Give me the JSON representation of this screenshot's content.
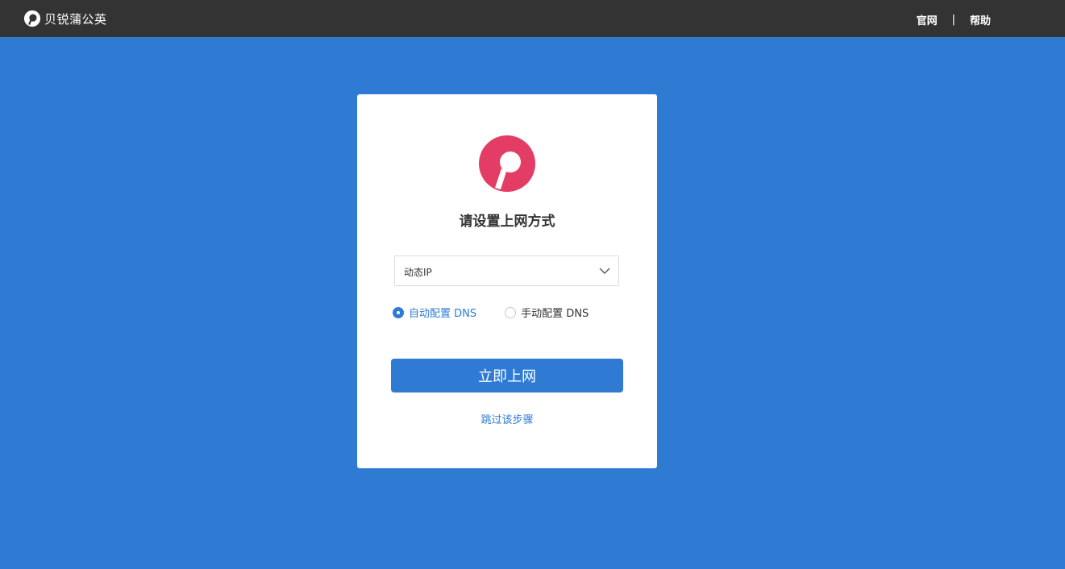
{
  "header": {
    "brand_name": "贝锐蒲公英",
    "nav": {
      "official_site": "官网",
      "separator": "|",
      "help": "帮助"
    }
  },
  "colors": {
    "accent": "#2f7bd4",
    "topbar": "#333333",
    "logo": "#e33d66"
  },
  "setup": {
    "title": "请设置上网方式",
    "connection_type": {
      "selected": "动态IP"
    },
    "dns_options": [
      {
        "label": "自动配置 DNS",
        "checked": true
      },
      {
        "label": "手动配置 DNS",
        "checked": false
      }
    ],
    "submit_label": "立即上网",
    "skip_label": "跳过该步骤"
  }
}
